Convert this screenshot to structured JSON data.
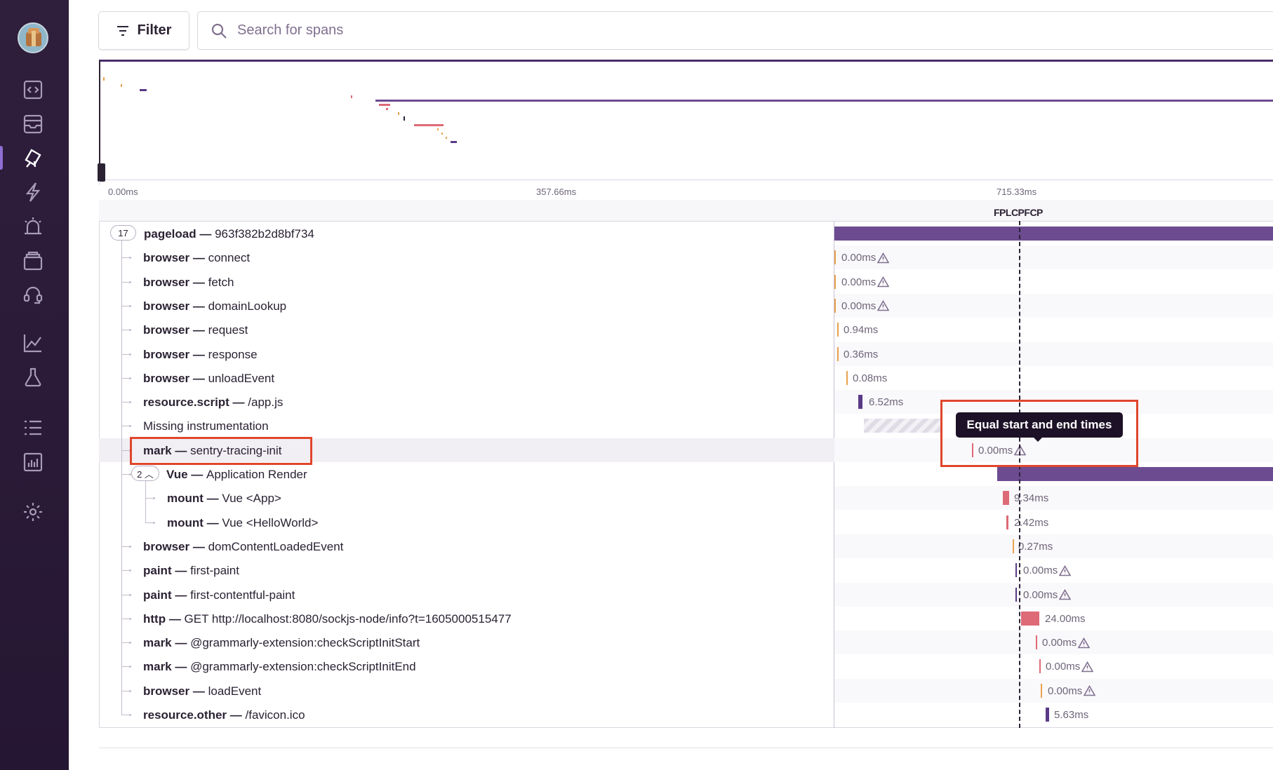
{
  "filter": {
    "label": "Filter"
  },
  "search": {
    "placeholder": "Search for spans"
  },
  "timeline": {
    "ticks": [
      "0.00ms",
      "357.66ms",
      "715.33ms"
    ],
    "marker": "FP|LCP|FCP",
    "marker_label": "FPLCPFCP"
  },
  "tooltip": {
    "text": "Equal start and end times"
  },
  "spans": [
    {
      "op": "pageload",
      "desc": "963f382b2d8bf734",
      "count": "17",
      "duration": ""
    },
    {
      "op": "browser",
      "desc": "connect",
      "duration": "0.00ms"
    },
    {
      "op": "browser",
      "desc": "fetch",
      "duration": "0.00ms"
    },
    {
      "op": "browser",
      "desc": "domainLookup",
      "duration": "0.00ms"
    },
    {
      "op": "browser",
      "desc": "request",
      "duration": "0.94ms"
    },
    {
      "op": "browser",
      "desc": "response",
      "duration": "0.36ms"
    },
    {
      "op": "browser",
      "desc": "unloadEvent",
      "duration": "0.08ms"
    },
    {
      "op": "resource.script",
      "desc": "/app.js",
      "duration": "6.52ms"
    },
    {
      "op": "",
      "desc": "Missing instrumentation",
      "duration": ""
    },
    {
      "op": "mark",
      "desc": "sentry-tracing-init",
      "duration": "0.00ms"
    },
    {
      "op": "Vue",
      "desc": "Application Render",
      "count": "2",
      "duration": ""
    },
    {
      "op": "mount",
      "desc": "Vue <App>",
      "duration": "9.34ms"
    },
    {
      "op": "mount",
      "desc": "Vue <HelloWorld>",
      "duration": "2.42ms"
    },
    {
      "op": "browser",
      "desc": "domContentLoadedEvent",
      "duration": "0.27ms"
    },
    {
      "op": "paint",
      "desc": "first-paint",
      "duration": "0.00ms"
    },
    {
      "op": "paint",
      "desc": "first-contentful-paint",
      "duration": "0.00ms"
    },
    {
      "op": "http",
      "desc": "GET http://localhost:8080/sockjs-node/info?t=1605000515477",
      "duration": "24.00ms"
    },
    {
      "op": "mark",
      "desc": "@grammarly-extension:checkScriptInitStart",
      "duration": "0.00ms"
    },
    {
      "op": "mark",
      "desc": "@grammarly-extension:checkScriptInitEnd",
      "duration": "0.00ms"
    },
    {
      "op": "browser",
      "desc": "loadEvent",
      "duration": "0.00ms"
    },
    {
      "op": "resource.other",
      "desc": "/favicon.ico",
      "duration": "5.63ms"
    }
  ],
  "sep": "—",
  "colors": {
    "purple": "#6c4b91",
    "pink": "#dd6a76",
    "orange": "#e9a14d",
    "violet": "#5a3a86",
    "hl": "#e0462d"
  }
}
